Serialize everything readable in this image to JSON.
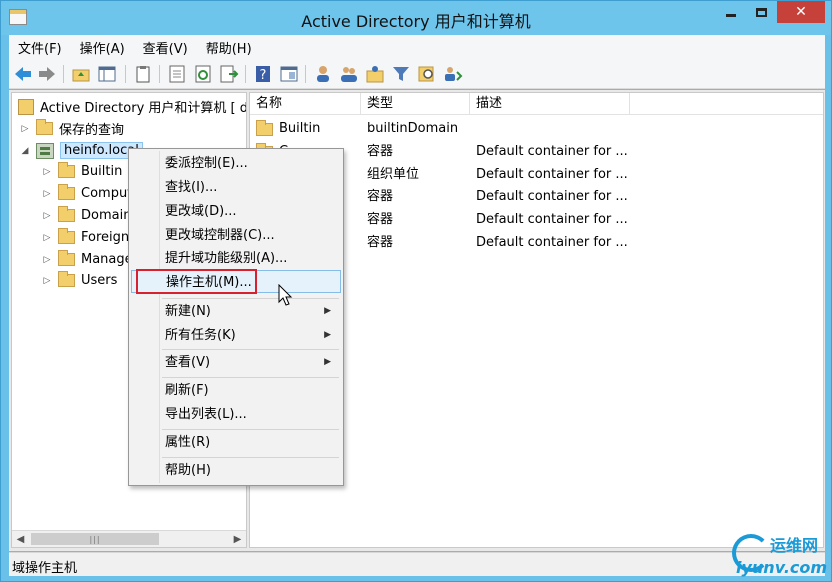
{
  "window": {
    "title": "Active Directory 用户和计算机"
  },
  "menu": [
    "文件(F)",
    "操作(A)",
    "查看(V)",
    "帮助(H)"
  ],
  "tree": {
    "root": "Active Directory 用户和计算机 [ dc",
    "saved_queries": "保存的查询",
    "domain": "heinfo.local",
    "children": [
      "Builtin",
      "Comput",
      "Domain",
      "Foreign",
      "Manage",
      "Users"
    ]
  },
  "list": {
    "columns": [
      "名称",
      "类型",
      "描述"
    ],
    "rows": [
      {
        "name": "Builtin",
        "type": "builtinDomain",
        "desc": ""
      },
      {
        "name": "C",
        "type": "容器",
        "desc": "Default container for ..."
      },
      {
        "name": "",
        "type": "组织单位",
        "desc": "Default container for ..."
      },
      {
        "name": "",
        "type": "容器",
        "desc": "Default container for ..."
      },
      {
        "name": "S",
        "type": "容器",
        "desc": "Default container for ..."
      },
      {
        "name": "",
        "type": "容器",
        "desc": "Default container for ..."
      }
    ]
  },
  "context_menu": [
    "委派控制(E)...",
    "查找(I)...",
    "更改域(D)...",
    "更改域控制器(C)...",
    "提升域功能级别(A)...",
    "操作主机(M)...",
    "新建(N)",
    "所有任务(K)",
    "查看(V)",
    "刷新(F)",
    "导出列表(L)...",
    "属性(R)",
    "帮助(H)"
  ],
  "status": "域操作主机",
  "watermark": {
    "cn": "运维网",
    "url": "iyunv.com"
  },
  "icons": {
    "submenu": "submenu-arrow-icon",
    "expand": "expand-arrow-icon"
  }
}
